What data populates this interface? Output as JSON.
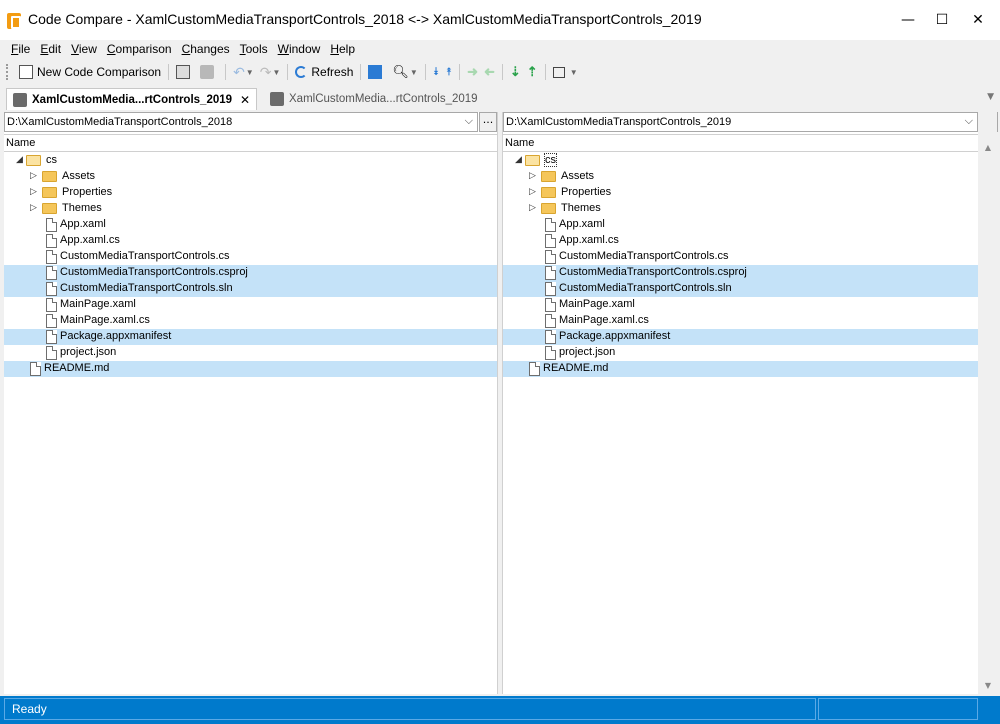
{
  "window": {
    "title": "Code Compare - XamlCustomMediaTransportControls_2018 <-> XamlCustomMediaTransportControls_2019",
    "minimize": "—",
    "maximize": "☐",
    "close": "✕"
  },
  "menu": [
    "File",
    "Edit",
    "View",
    "Comparison",
    "Changes",
    "Tools",
    "Window",
    "Help"
  ],
  "toolbar": {
    "new_comparison": "New Code Comparison",
    "refresh": "Refresh"
  },
  "tabs": [
    {
      "label": "XamlCustomMedia...rtControls_2019",
      "active": true
    },
    {
      "label": "XamlCustomMedia...rtControls_2019",
      "active": false
    }
  ],
  "left": {
    "path": "D:\\XamlCustomMediaTransportControls_2018",
    "header": "Name"
  },
  "right": {
    "path": "D:\\XamlCustomMediaTransportControls_2019",
    "header": "Name"
  },
  "tree": [
    {
      "name": "cs",
      "type": "folder-open",
      "level": 0,
      "expander": "◢",
      "highlight": false
    },
    {
      "name": "Assets",
      "type": "folder",
      "level": 1,
      "expander": "▷",
      "highlight": false
    },
    {
      "name": "Properties",
      "type": "folder",
      "level": 1,
      "expander": "▷",
      "highlight": false
    },
    {
      "name": "Themes",
      "type": "folder",
      "level": 1,
      "expander": "▷",
      "highlight": false
    },
    {
      "name": "App.xaml",
      "type": "file",
      "level": 1,
      "highlight": false
    },
    {
      "name": "App.xaml.cs",
      "type": "file",
      "level": 1,
      "highlight": false
    },
    {
      "name": "CustomMediaTransportControls.cs",
      "type": "file",
      "level": 1,
      "highlight": false
    },
    {
      "name": "CustomMediaTransportControls.csproj",
      "type": "file",
      "level": 1,
      "highlight": true
    },
    {
      "name": "CustomMediaTransportControls.sln",
      "type": "file",
      "level": 1,
      "highlight": true
    },
    {
      "name": "MainPage.xaml",
      "type": "file",
      "level": 1,
      "highlight": false
    },
    {
      "name": "MainPage.xaml.cs",
      "type": "file",
      "level": 1,
      "highlight": false
    },
    {
      "name": "Package.appxmanifest",
      "type": "file",
      "level": 1,
      "highlight": true
    },
    {
      "name": "project.json",
      "type": "file",
      "level": 1,
      "highlight": false
    },
    {
      "name": "README.md",
      "type": "file",
      "level": 0,
      "highlight": true
    }
  ],
  "status": {
    "text": "Ready"
  },
  "colors": {
    "highlight": "#c4e2f8",
    "status_bar": "#007acc"
  }
}
